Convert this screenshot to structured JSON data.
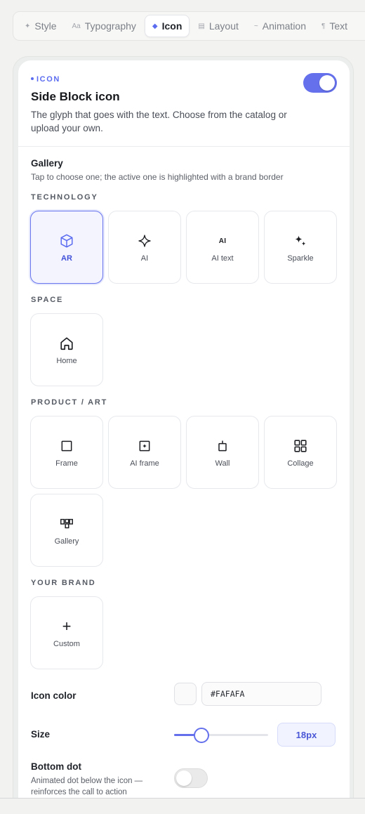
{
  "tabs": [
    {
      "icon": "✦",
      "label": "Style"
    },
    {
      "icon": "Aa",
      "label": "Typography"
    },
    {
      "icon": "◆",
      "label": "Icon"
    },
    {
      "icon": "▤",
      "label": "Layout"
    },
    {
      "icon": "~",
      "label": "Animation"
    },
    {
      "icon": "¶",
      "label": "Text"
    }
  ],
  "header": {
    "eyebrow": "ICON",
    "title": "Side Block icon",
    "description": "The glyph that goes with the text. Choose from the catalog or upload your own.",
    "enabled": true
  },
  "gallery": {
    "title": "Gallery",
    "description": "Tap to choose one; the active one is highlighted with a brand border",
    "categories": [
      {
        "name": "TECHNOLOGY",
        "items": [
          {
            "label": "AR",
            "icon": "cube-icon",
            "selected": true
          },
          {
            "label": "AI",
            "icon": "sparkle-star-icon"
          },
          {
            "label": "AI text",
            "icon": "ai-text-icon",
            "glyph": "AI"
          },
          {
            "label": "Sparkle",
            "icon": "sparkles-icon"
          }
        ]
      },
      {
        "name": "SPACE",
        "items": [
          {
            "label": "Home",
            "icon": "home-icon"
          }
        ]
      },
      {
        "name": "PRODUCT / ART",
        "items": [
          {
            "label": "Frame",
            "icon": "frame-icon"
          },
          {
            "label": "AI frame",
            "icon": "ai-frame-icon"
          },
          {
            "label": "Wall",
            "icon": "wall-icon"
          },
          {
            "label": "Collage",
            "icon": "collage-icon"
          },
          {
            "label": "Gallery",
            "icon": "gallery-icon"
          }
        ]
      },
      {
        "name": "YOUR BRAND",
        "items": [
          {
            "label": "Custom",
            "icon": "plus-icon",
            "glyph": "+"
          }
        ]
      }
    ]
  },
  "icon_color": {
    "label": "Icon color",
    "value": "#FAFAFA"
  },
  "size": {
    "label": "Size",
    "value": "18px",
    "level": 0.29
  },
  "bottom_dot": {
    "label": "Bottom dot",
    "description": "Animated dot below the icon — reinforces the call to action",
    "enabled": false
  },
  "colors": {
    "accent": "#6571EC",
    "swatch": "#FAFAFA"
  }
}
